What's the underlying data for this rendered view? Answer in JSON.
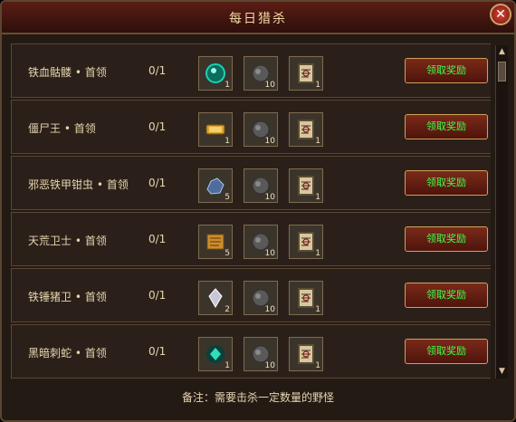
{
  "window": {
    "title": "每日猎杀",
    "close_icon": "close-icon"
  },
  "rows": [
    {
      "boss": "铁血骷髅 • 首领",
      "progress": "0/1",
      "items": [
        {
          "icon": "green-orb-icon",
          "count": "1"
        },
        {
          "icon": "stone-icon",
          "count": "10"
        },
        {
          "icon": "scroll-book-icon",
          "count": "1"
        }
      ],
      "button": "领取奖励"
    },
    {
      "boss": "僵尸王 • 首领",
      "progress": "0/1",
      "items": [
        {
          "icon": "gold-bar-icon",
          "count": "1"
        },
        {
          "icon": "stone-icon",
          "count": "10"
        },
        {
          "icon": "scroll-book-icon",
          "count": "1"
        }
      ],
      "button": "领取奖励"
    },
    {
      "boss": "邪恶铁甲钳虫 • 首领",
      "progress": "0/1",
      "items": [
        {
          "icon": "ore-icon",
          "count": "5"
        },
        {
          "icon": "stone-icon",
          "count": "10"
        },
        {
          "icon": "scroll-book-icon",
          "count": "1"
        }
      ],
      "button": "领取奖励"
    },
    {
      "boss": "天荒卫士 • 首领",
      "progress": "0/1",
      "items": [
        {
          "icon": "map-scroll-icon",
          "count": "5"
        },
        {
          "icon": "stone-icon",
          "count": "10"
        },
        {
          "icon": "scroll-book-icon",
          "count": "1"
        }
      ],
      "button": "领取奖励"
    },
    {
      "boss": "铁锤猪卫 • 首领",
      "progress": "0/1",
      "items": [
        {
          "icon": "crystal-icon",
          "count": "2"
        },
        {
          "icon": "stone-icon",
          "count": "10"
        },
        {
          "icon": "scroll-book-icon",
          "count": "1"
        }
      ],
      "button": "领取奖励"
    },
    {
      "boss": "黑暗刺蛇 • 首领",
      "progress": "0/1",
      "items": [
        {
          "icon": "green-gem-icon",
          "count": "1"
        },
        {
          "icon": "stone-icon",
          "count": "10"
        },
        {
          "icon": "scroll-book-icon",
          "count": "1"
        }
      ],
      "button": "领取奖励"
    }
  ],
  "footer_note": "备注：需要击杀一定数量的野怪"
}
